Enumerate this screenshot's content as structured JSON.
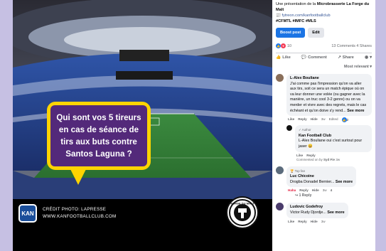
{
  "post_image": {
    "question": "Qui sont vos 5 tireurs en cas de séance de tirs aux buts contre Santos Laguna ?",
    "brand_badge": "KAN",
    "credit_line1": "CRÉDIT PHOTO: LAPRESSE",
    "credit_line2": "WWW.KANFOOTBALLCLUB.COM",
    "seal_text": "FORGE DU MALT"
  },
  "post": {
    "desc_line1": "Une présentation de la",
    "desc_bold": "Microbrasserie La Forge du Malt",
    "desc_link": "📰 fytreon.com/kanfootballclub",
    "hashtags": "#CFMTL #IMFC #MLS",
    "boost_label": "Boost post",
    "edit_label": "Edit",
    "reaction_count": "10",
    "comments_shares": "13 Comments  4 Shares",
    "like_label": "Like",
    "comment_label": "Comment",
    "share_label": "Share",
    "sort_label": "Most relevant ▾"
  },
  "comments": [
    {
      "name": "L-Alex Bouliane",
      "text": "J'ai comme pas l'impression qu'on va aller aux tirs, soit ce sera un match épique où on va leur donner une volée (ou gagner avec la manière, un truc cool 3-2 genre) ou on va merder et vivre avec des regrets, mais le cas échéant et qu'on doive s'y rend...",
      "see_more": "See more",
      "like": "Like",
      "reply": "Reply",
      "hide": "Hide",
      "time": "3w",
      "edited": "Edited",
      "reactions": "2"
    },
    {
      "author_tag": "✓ Author",
      "name": "Kan Football Club",
      "text": "L-Alex Bouliane oui c'est surtout pour jaser 😄",
      "like": "Like",
      "reply": "Reply",
      "commented_on_by": "Commented on by",
      "commented_by_name": "Syd Fie",
      "time": "3w"
    },
    {
      "badge": "🏆 Top fan",
      "name": "Luc Chicoine",
      "text": "Drogba Donadel Bernier...",
      "see_more": "See more",
      "like": "Haha",
      "reply": "Reply",
      "hide": "Hide",
      "time": "3w",
      "reactions": "4",
      "replies": "↪ 1 Reply"
    },
    {
      "name": "Ludovic Godefroy",
      "text": "Victor Rudy Djordje...",
      "see_more": "See more",
      "like": "Like",
      "reply": "Reply",
      "hide": "Hide",
      "time": "3w"
    }
  ],
  "colors": {
    "background": "#c6c0e3",
    "speech_bg": "#53297a",
    "speech_border": "#ffd400",
    "boost": "#1b74e4"
  }
}
